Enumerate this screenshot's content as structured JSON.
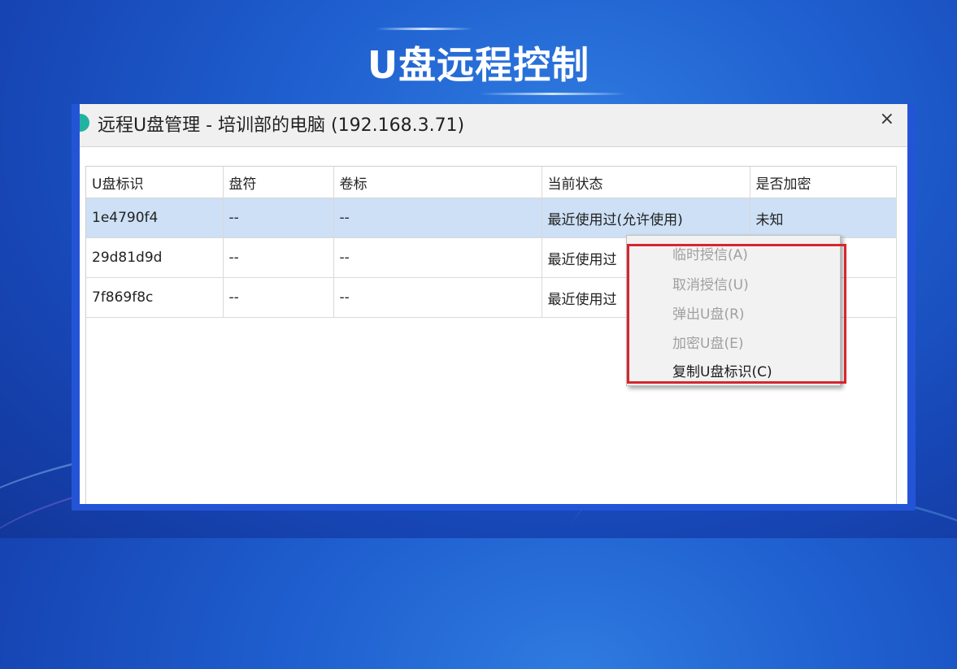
{
  "slide": {
    "title": "U盘远程控制"
  },
  "window": {
    "title": "远程U盘管理 - 培训部的电脑 (192.168.3.71)",
    "close_label": "×"
  },
  "table": {
    "headers": [
      "U盘标识",
      "盘符",
      "卷标",
      "当前状态",
      "是否加密"
    ],
    "rows": [
      [
        "1e4790f4",
        "--",
        "--",
        "最近使用过(允许使用)",
        "未知"
      ],
      [
        "29d81d9d",
        "--",
        "--",
        "最近使用过",
        ""
      ],
      [
        "7f869f8c",
        "--",
        "--",
        "最近使用过",
        ""
      ]
    ],
    "selected_row": 0
  },
  "context_menu": {
    "items": [
      {
        "label": "临时授信(A)",
        "enabled": false
      },
      {
        "label": "取消授信(U)",
        "enabled": false
      },
      {
        "label": "弹出U盘(R)",
        "enabled": false
      },
      {
        "label": "加密U盘(E)",
        "enabled": false
      },
      {
        "label": "复制U盘标识(C)",
        "enabled": true
      }
    ]
  },
  "colors": {
    "highlight_border": "#d6262e",
    "selected_row": "#cde0f5",
    "frame": "#2454d6"
  }
}
